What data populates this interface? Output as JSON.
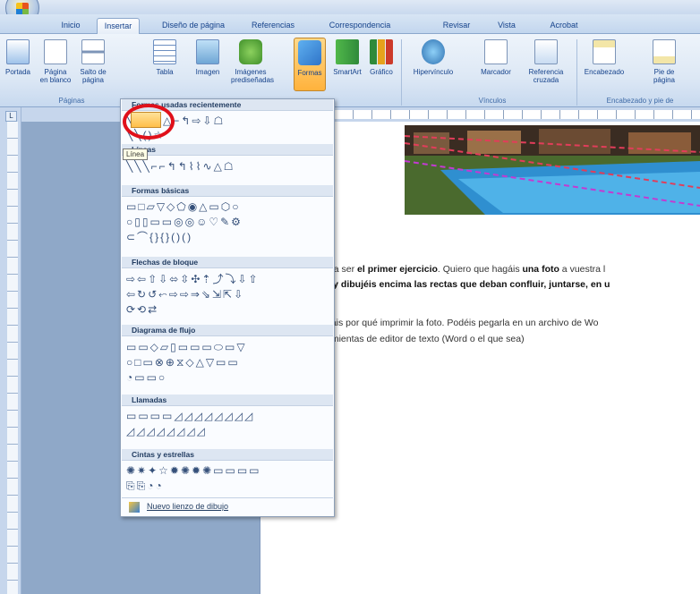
{
  "ribbon": {
    "tabs": [
      "Inicio",
      "Insertar",
      "Diseño de página",
      "Referencias",
      "Correspondencia",
      "Revisar",
      "Vista",
      "Acrobat"
    ],
    "active_tab": "Insertar",
    "buttons": [
      {
        "label": "Portada",
        "icon": "cover-page-icon"
      },
      {
        "label": "Página en blanco",
        "icon": "blank-page-icon"
      },
      {
        "label": "Salto de página",
        "icon": "page-break-icon"
      },
      {
        "label": "Tabla",
        "icon": "table-icon"
      },
      {
        "label": "Imagen",
        "icon": "picture-icon"
      },
      {
        "label": "Imágenes prediseñadas",
        "icon": "clip-art-icon"
      },
      {
        "label": "Formas",
        "icon": "shapes-icon"
      },
      {
        "label": "SmartArt",
        "icon": "smartart-icon"
      },
      {
        "label": "Gráfico",
        "icon": "chart-icon"
      },
      {
        "label": "Hipervínculo",
        "icon": "hyperlink-icon"
      },
      {
        "label": "Marcador",
        "icon": "bookmark-icon"
      },
      {
        "label": "Referencia cruzada",
        "icon": "cross-reference-icon"
      },
      {
        "label": "Encabezado",
        "icon": "header-icon"
      },
      {
        "label": "Pie de página",
        "icon": "footer-icon"
      }
    ],
    "groups": [
      "Páginas",
      "Vínculos",
      "Encabezado y pie de"
    ]
  },
  "shapes_menu": {
    "sections": [
      {
        "title": "Formas usadas recientemente",
        "rows": [
          "╲▭○□△⌐↰⇨⇩☖",
          "╲╲()☆"
        ]
      },
      {
        "title": "Líneas",
        "rows": [
          "╲╲╲⌐⌐↰↰⌇⌇∿△☖"
        ]
      },
      {
        "title": "Formas básicas",
        "rows": [
          "▭□▱▽◇⬠◉△▭⬡○",
          "○▯▯▭▭◎◎☺♡✎⚙",
          "⊂⌒{}{}()()"
        ]
      },
      {
        "title": "Flechas de bloque",
        "rows": [
          "⇨⇦⇧⇩⬄⇳✣⇡⤴⤵⇩⇧",
          "⇦↻↺⬿⇨⇨⇒⇘⇲⇱⇩",
          "⟳⟲⇄"
        ]
      },
      {
        "title": "Diagrama de flujo",
        "rows": [
          "▭▭◇▱▯▭▭▭⬭▭▽",
          "○□▭⊗⊕⧖◇△▽▭▭",
          "◔▭▭○"
        ]
      },
      {
        "title": "Llamadas",
        "rows": [
          "▭▭▭▭◿◿◿◿◿◿◿◿",
          "◿◿◿◿◿◿◿◿"
        ]
      },
      {
        "title": "Cintas y estrellas",
        "rows": [
          "✺✷✦☆✹✺✹✺▭▭▭▭",
          "⎘⎘◔◔"
        ]
      }
    ],
    "tooltip": "Línea",
    "footer": "Nuevo lienzo de dibujo"
  },
  "document": {
    "line1_start": "a a ser ",
    "line1_bold": "el primer ejercicio",
    "line1_mid": ". Quiero que hagáis ",
    "line1_bold2": "una foto",
    "line1_end": " a vuestra l",
    "line2_start": "s ",
    "line2_bold": "y dibujéis encima las rectas que deban confluir, juntarse, en u",
    "line3": "náis por qué imprimir la foto. Podéis pegarla en un archivo de Wo",
    "line4": "amientas de editor de texto (Word o el que sea)"
  },
  "colors": {
    "accent": "#ffb23c",
    "highlight_circle": "#e0101a",
    "ribbon": "#dde8f5"
  }
}
